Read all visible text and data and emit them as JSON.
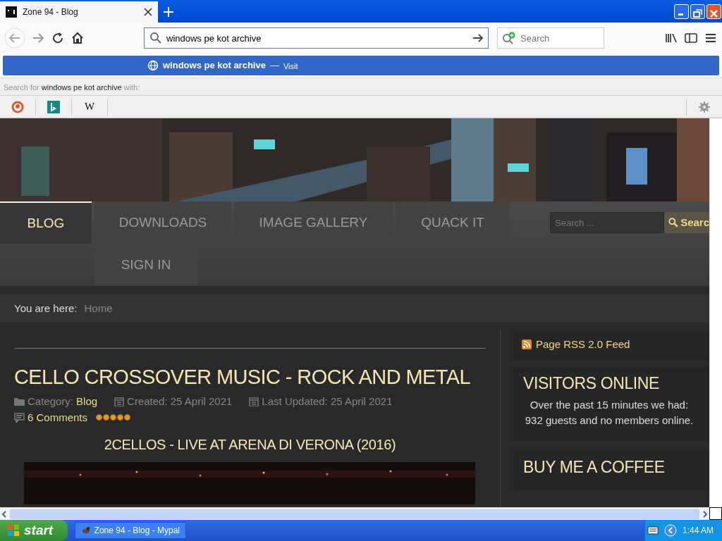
{
  "browser": {
    "tab": {
      "title": "Zone 94 - Blog",
      "selected": true
    },
    "url_field": {
      "value": "windows pe kot archive"
    },
    "search_field": {
      "placeholder": "Search"
    },
    "suggestion": {
      "text": "windows pe kot archive",
      "separator": "—",
      "action": "Visit",
      "selected": true
    },
    "search_with": {
      "prefix": "Search for",
      "query": "windows pe kot archive",
      "suffix": "with:"
    },
    "engines": [
      {
        "kind": "duckduckgo"
      },
      {
        "kind": "bing"
      },
      {
        "kind": "wikipedia",
        "label": "W"
      }
    ]
  },
  "site": {
    "nav": [
      {
        "label": "BLOG",
        "selected": true
      },
      {
        "label": "DOWNLOADS",
        "selected": false
      },
      {
        "label": "IMAGE GALLERY",
        "selected": false
      },
      {
        "label": "QUACK IT",
        "selected": false
      },
      {
        "label": "SIGN IN",
        "selected": false
      }
    ],
    "search": {
      "placeholder": "Search ...",
      "button": "Searc"
    },
    "breadcrumb": {
      "label": "You are here:",
      "item": "Home"
    },
    "article": {
      "title": "CELLO CROSSOVER MUSIC - ROCK AND METAL",
      "category_label": "Category:",
      "category": "Blog",
      "created": "Created: 25 April 2021",
      "updated": "Last Updated: 25 April 2021",
      "comments": "6 Comments",
      "stars": 5,
      "video_title": "2CELLOS - LIVE AT ARENA DI VERONA (2016)"
    },
    "sidebar": {
      "rss": "Page RSS 2.0 Feed",
      "visitors": {
        "title": "VISITORS ONLINE",
        "text": "Over the past 15 minutes we had: 932 guests and no members online."
      },
      "coffee": {
        "title": "BUY ME A COFFEE"
      }
    }
  },
  "taskbar": {
    "start": "start",
    "task": "Zone 94 - Blog - Mypal",
    "clock": "1:44 AM"
  }
}
